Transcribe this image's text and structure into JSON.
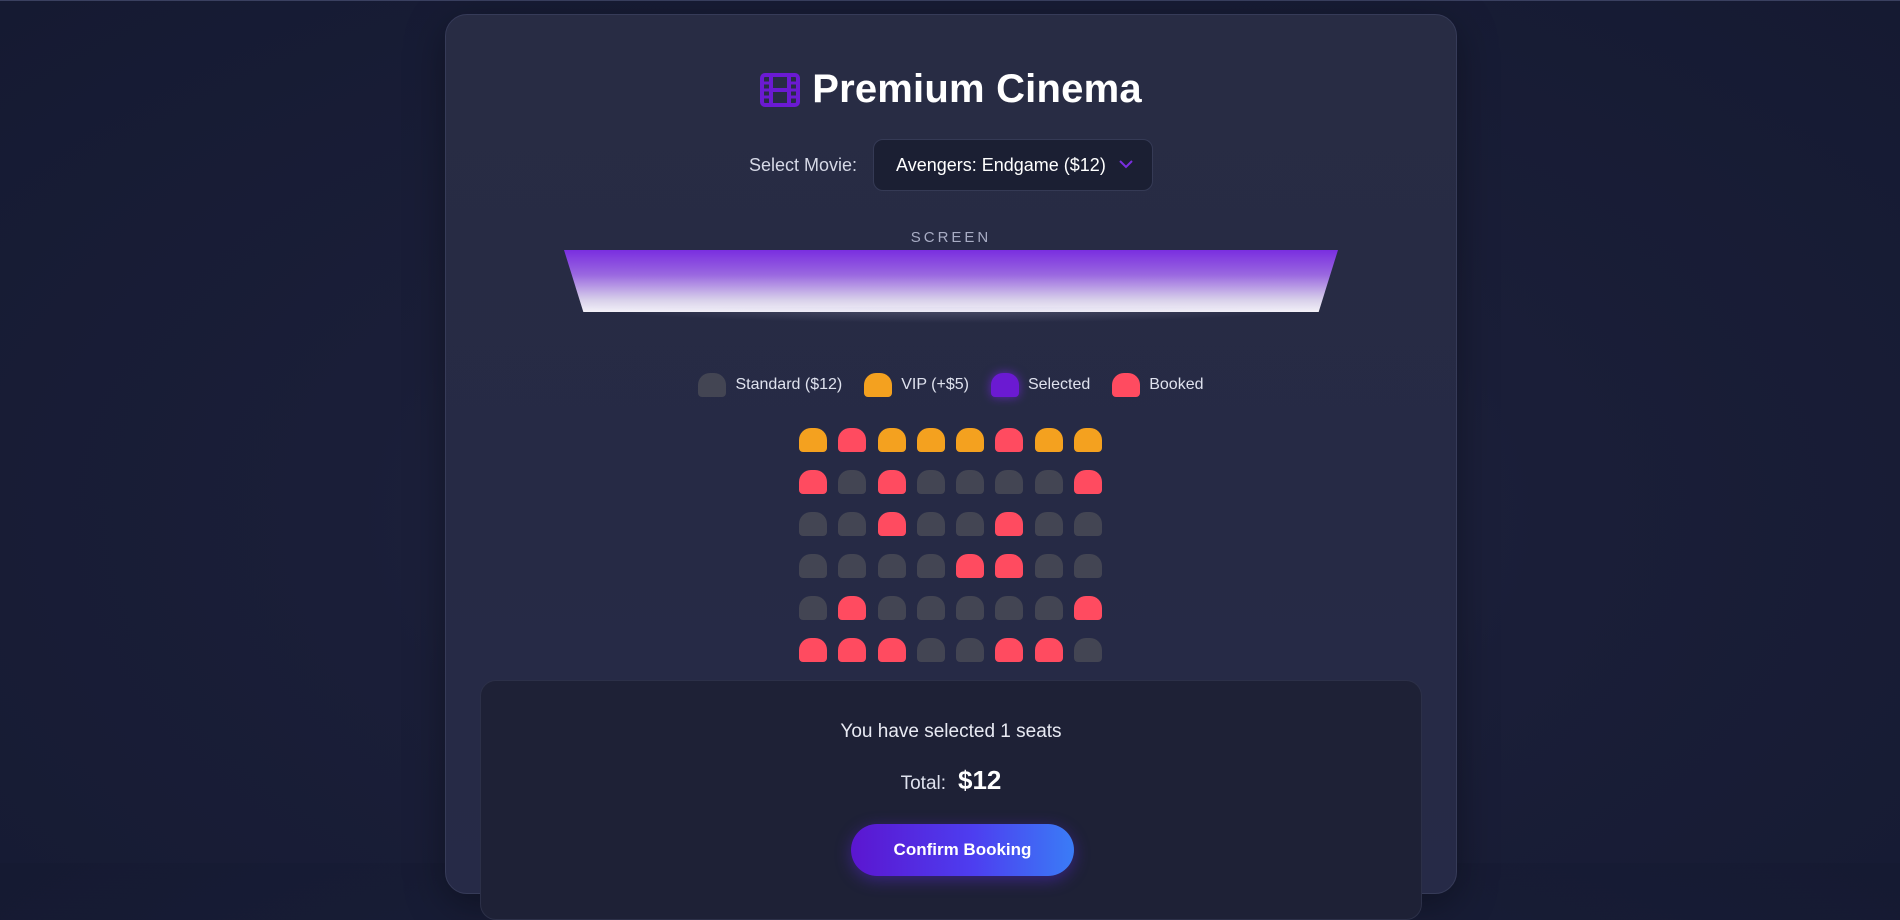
{
  "app": {
    "title": "Premium Cinema",
    "icon": "film-icon"
  },
  "movie_select": {
    "label": "Select Movie:",
    "value": "Avengers: Endgame ($12)"
  },
  "screen": {
    "label": "SCREEN"
  },
  "legend": [
    {
      "type": "standard",
      "label": "Standard ($12)"
    },
    {
      "type": "vip",
      "label": "VIP (+$5)"
    },
    {
      "type": "selected",
      "label": "Selected"
    },
    {
      "type": "booked",
      "label": "Booked"
    }
  ],
  "seats": [
    [
      "vip",
      "booked",
      "vip",
      "vip",
      "vip",
      "booked",
      "vip",
      "vip"
    ],
    [
      "booked",
      "standard",
      "booked",
      "standard",
      "standard",
      "standard",
      "standard",
      "booked"
    ],
    [
      "standard",
      "standard",
      "booked",
      "standard",
      "standard",
      "booked",
      "standard",
      "standard"
    ],
    [
      "standard",
      "standard",
      "standard",
      "standard",
      "booked",
      "booked",
      "standard",
      "standard"
    ],
    [
      "standard",
      "booked",
      "standard",
      "standard",
      "standard",
      "standard",
      "standard",
      "booked"
    ],
    [
      "booked",
      "booked",
      "booked",
      "standard",
      "standard",
      "booked",
      "booked",
      "standard"
    ]
  ],
  "summary": {
    "selected_text": "You have selected 1 seats",
    "total_label": "Total:",
    "total_value": "$12",
    "confirm_label": "Confirm Booking"
  },
  "colors": {
    "standard": "#434553",
    "vip": "#f4a11f",
    "selected": "#6b1ad2",
    "booked": "#ff4b60",
    "accent": "#6b1ad2"
  }
}
